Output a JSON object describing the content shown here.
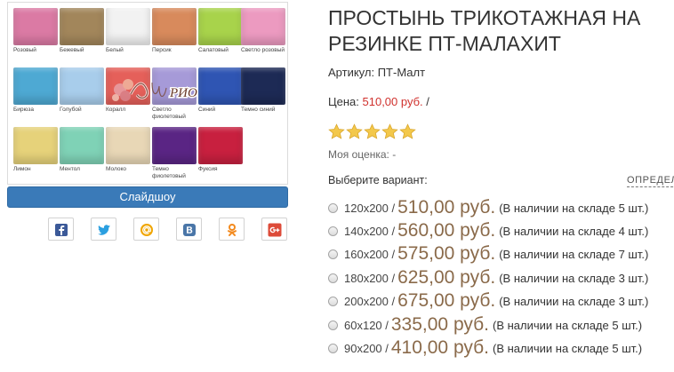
{
  "product": {
    "title": "ПРОСТЫНЬ ТРИКОТАЖНАЯ НА РЕЗИНКЕ ПТ-МАЛАХИТ",
    "article_label": "Артикул:",
    "article_value": "ПТ-Малт",
    "price_label": "Цена:",
    "price_value": "510,00 руб.",
    "price_sep": "/",
    "rating_label": "Моя оценка:",
    "rating_value": "-",
    "stars_count": 5,
    "star_color": "#f3c84b"
  },
  "gallery": {
    "watermark_text": "РИО",
    "slideshow_label": "Слайдшоу",
    "swatches": [
      {
        "label": "Розовый",
        "color": "#db7aa4"
      },
      {
        "label": "Бежевый",
        "color": "#a2865b"
      },
      {
        "label": "Белый",
        "color": "#f2f2f2"
      },
      {
        "label": "Персик",
        "color": "#d88a5c"
      },
      {
        "label": "Салатовый",
        "color": "#a8d34b"
      },
      {
        "label": "Светло розовый",
        "color": "#ec9ac0"
      },
      {
        "label": "Бирюза",
        "color": "#4ea9d3"
      },
      {
        "label": "Голубой",
        "color": "#a8cdeb"
      },
      {
        "label": "Коралл",
        "color": "#e5605a"
      },
      {
        "label": "Светло фиолетовый",
        "color": "#a69ad8"
      },
      {
        "label": "Синий",
        "color": "#2f55b3"
      },
      {
        "label": "Темно синий",
        "color": "#1d2a55"
      },
      {
        "label": "Лимон",
        "color": "#e6d27a"
      },
      {
        "label": "Ментол",
        "color": "#7fd2b6"
      },
      {
        "label": "Молоко",
        "color": "#e8d7b6"
      },
      {
        "label": "Темно фиолетовый",
        "color": "#5a2584"
      },
      {
        "label": "Фуксия",
        "color": "#c8203f"
      }
    ]
  },
  "social": [
    {
      "name": "facebook",
      "color": "#3b5998"
    },
    {
      "name": "twitter",
      "color": "#2a9fe0"
    },
    {
      "name": "mail",
      "color": "#f0a500"
    },
    {
      "name": "vkontakte",
      "color": "#4a76a8"
    },
    {
      "name": "odnoklassniki",
      "color": "#f38a1e"
    },
    {
      "name": "google-plus",
      "color": "#dd4b39"
    }
  ],
  "variants": {
    "label": "Выберите вариант:",
    "determine_link": "ОПРЕДЕЛ",
    "items": [
      {
        "size": "120x200 /",
        "price": "510,00 руб.",
        "stock": "(В наличии на складе 5 шт.)"
      },
      {
        "size": "140x200 /",
        "price": "560,00 руб.",
        "stock": "(В наличии на складе 4 шт.)"
      },
      {
        "size": "160x200 /",
        "price": "575,00 руб.",
        "stock": "(В наличии на складе 7 шт.)"
      },
      {
        "size": "180x200 /",
        "price": "625,00 руб.",
        "stock": "(В наличии на складе 3 шт.)"
      },
      {
        "size": "200x200 /",
        "price": "675,00 руб.",
        "stock": "(В наличии на складе 3 шт.)"
      },
      {
        "size": "60x120 /",
        "price": "335,00 руб.",
        "stock": "(В наличии на складе 5 шт.)"
      },
      {
        "size": "90x200 /",
        "price": "410,00 руб.",
        "stock": "(В наличии на складе 5 шт.)"
      }
    ]
  }
}
